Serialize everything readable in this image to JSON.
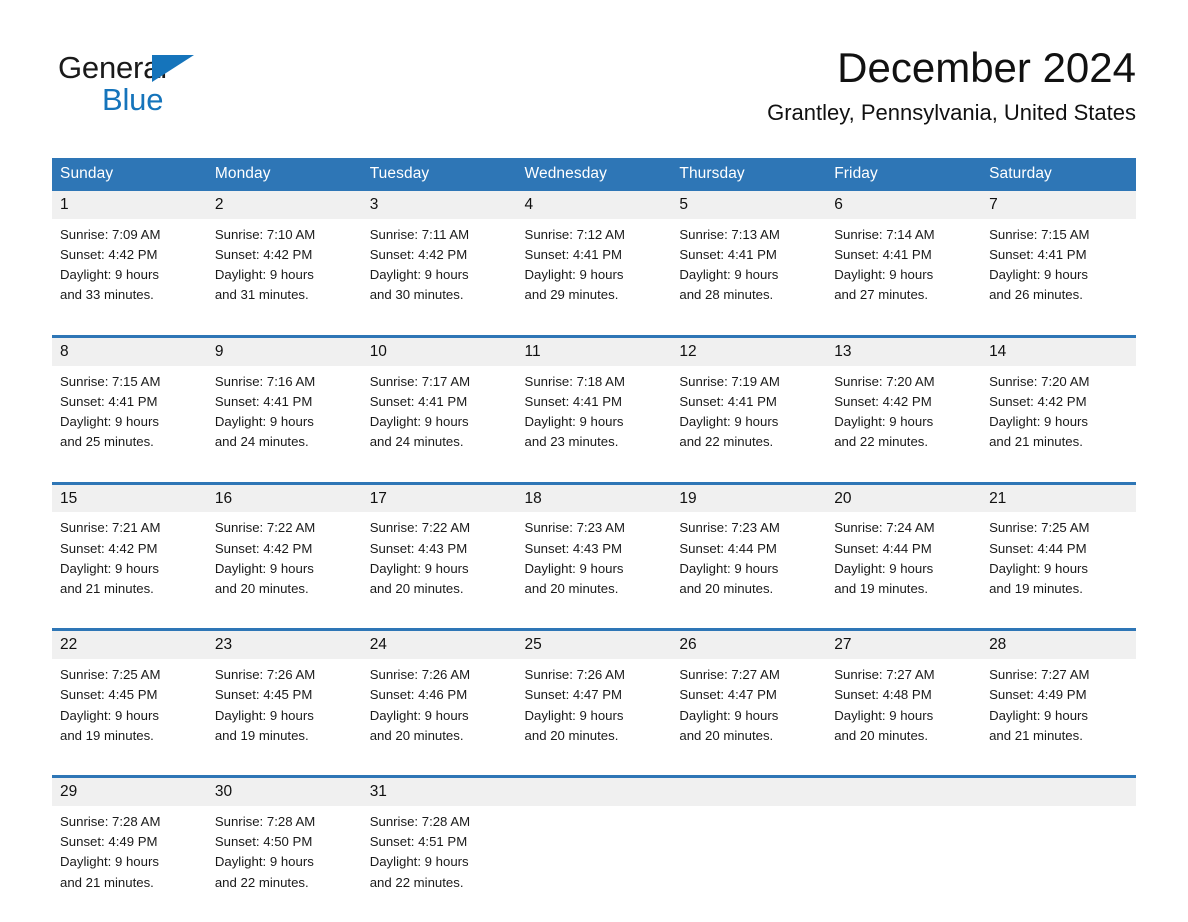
{
  "brand": {
    "name_part1": "General",
    "name_part2": "Blue",
    "triangle_icon": "triangle-logo-icon",
    "color_primary": "#1574bb"
  },
  "header": {
    "title": "December 2024",
    "location": "Grantley, Pennsylvania, United States"
  },
  "theme": {
    "header_blue": "#2e76b6",
    "daynum_band": "#f0f0f0",
    "text": "#1a1a1a"
  },
  "calendar": {
    "weekday_headers": [
      "Sunday",
      "Monday",
      "Tuesday",
      "Wednesday",
      "Thursday",
      "Friday",
      "Saturday"
    ],
    "weeks": [
      {
        "days": [
          {
            "day": "1",
            "sunrise": "Sunrise: 7:09 AM",
            "sunset": "Sunset: 4:42 PM",
            "daylight_line1": "Daylight: 9 hours",
            "daylight_line2": "and 33 minutes."
          },
          {
            "day": "2",
            "sunrise": "Sunrise: 7:10 AM",
            "sunset": "Sunset: 4:42 PM",
            "daylight_line1": "Daylight: 9 hours",
            "daylight_line2": "and 31 minutes."
          },
          {
            "day": "3",
            "sunrise": "Sunrise: 7:11 AM",
            "sunset": "Sunset: 4:42 PM",
            "daylight_line1": "Daylight: 9 hours",
            "daylight_line2": "and 30 minutes."
          },
          {
            "day": "4",
            "sunrise": "Sunrise: 7:12 AM",
            "sunset": "Sunset: 4:41 PM",
            "daylight_line1": "Daylight: 9 hours",
            "daylight_line2": "and 29 minutes."
          },
          {
            "day": "5",
            "sunrise": "Sunrise: 7:13 AM",
            "sunset": "Sunset: 4:41 PM",
            "daylight_line1": "Daylight: 9 hours",
            "daylight_line2": "and 28 minutes."
          },
          {
            "day": "6",
            "sunrise": "Sunrise: 7:14 AM",
            "sunset": "Sunset: 4:41 PM",
            "daylight_line1": "Daylight: 9 hours",
            "daylight_line2": "and 27 minutes."
          },
          {
            "day": "7",
            "sunrise": "Sunrise: 7:15 AM",
            "sunset": "Sunset: 4:41 PM",
            "daylight_line1": "Daylight: 9 hours",
            "daylight_line2": "and 26 minutes."
          }
        ]
      },
      {
        "days": [
          {
            "day": "8",
            "sunrise": "Sunrise: 7:15 AM",
            "sunset": "Sunset: 4:41 PM",
            "daylight_line1": "Daylight: 9 hours",
            "daylight_line2": "and 25 minutes."
          },
          {
            "day": "9",
            "sunrise": "Sunrise: 7:16 AM",
            "sunset": "Sunset: 4:41 PM",
            "daylight_line1": "Daylight: 9 hours",
            "daylight_line2": "and 24 minutes."
          },
          {
            "day": "10",
            "sunrise": "Sunrise: 7:17 AM",
            "sunset": "Sunset: 4:41 PM",
            "daylight_line1": "Daylight: 9 hours",
            "daylight_line2": "and 24 minutes."
          },
          {
            "day": "11",
            "sunrise": "Sunrise: 7:18 AM",
            "sunset": "Sunset: 4:41 PM",
            "daylight_line1": "Daylight: 9 hours",
            "daylight_line2": "and 23 minutes."
          },
          {
            "day": "12",
            "sunrise": "Sunrise: 7:19 AM",
            "sunset": "Sunset: 4:41 PM",
            "daylight_line1": "Daylight: 9 hours",
            "daylight_line2": "and 22 minutes."
          },
          {
            "day": "13",
            "sunrise": "Sunrise: 7:20 AM",
            "sunset": "Sunset: 4:42 PM",
            "daylight_line1": "Daylight: 9 hours",
            "daylight_line2": "and 22 minutes."
          },
          {
            "day": "14",
            "sunrise": "Sunrise: 7:20 AM",
            "sunset": "Sunset: 4:42 PM",
            "daylight_line1": "Daylight: 9 hours",
            "daylight_line2": "and 21 minutes."
          }
        ]
      },
      {
        "days": [
          {
            "day": "15",
            "sunrise": "Sunrise: 7:21 AM",
            "sunset": "Sunset: 4:42 PM",
            "daylight_line1": "Daylight: 9 hours",
            "daylight_line2": "and 21 minutes."
          },
          {
            "day": "16",
            "sunrise": "Sunrise: 7:22 AM",
            "sunset": "Sunset: 4:42 PM",
            "daylight_line1": "Daylight: 9 hours",
            "daylight_line2": "and 20 minutes."
          },
          {
            "day": "17",
            "sunrise": "Sunrise: 7:22 AM",
            "sunset": "Sunset: 4:43 PM",
            "daylight_line1": "Daylight: 9 hours",
            "daylight_line2": "and 20 minutes."
          },
          {
            "day": "18",
            "sunrise": "Sunrise: 7:23 AM",
            "sunset": "Sunset: 4:43 PM",
            "daylight_line1": "Daylight: 9 hours",
            "daylight_line2": "and 20 minutes."
          },
          {
            "day": "19",
            "sunrise": "Sunrise: 7:23 AM",
            "sunset": "Sunset: 4:44 PM",
            "daylight_line1": "Daylight: 9 hours",
            "daylight_line2": "and 20 minutes."
          },
          {
            "day": "20",
            "sunrise": "Sunrise: 7:24 AM",
            "sunset": "Sunset: 4:44 PM",
            "daylight_line1": "Daylight: 9 hours",
            "daylight_line2": "and 19 minutes."
          },
          {
            "day": "21",
            "sunrise": "Sunrise: 7:25 AM",
            "sunset": "Sunset: 4:44 PM",
            "daylight_line1": "Daylight: 9 hours",
            "daylight_line2": "and 19 minutes."
          }
        ]
      },
      {
        "days": [
          {
            "day": "22",
            "sunrise": "Sunrise: 7:25 AM",
            "sunset": "Sunset: 4:45 PM",
            "daylight_line1": "Daylight: 9 hours",
            "daylight_line2": "and 19 minutes."
          },
          {
            "day": "23",
            "sunrise": "Sunrise: 7:26 AM",
            "sunset": "Sunset: 4:45 PM",
            "daylight_line1": "Daylight: 9 hours",
            "daylight_line2": "and 19 minutes."
          },
          {
            "day": "24",
            "sunrise": "Sunrise: 7:26 AM",
            "sunset": "Sunset: 4:46 PM",
            "daylight_line1": "Daylight: 9 hours",
            "daylight_line2": "and 20 minutes."
          },
          {
            "day": "25",
            "sunrise": "Sunrise: 7:26 AM",
            "sunset": "Sunset: 4:47 PM",
            "daylight_line1": "Daylight: 9 hours",
            "daylight_line2": "and 20 minutes."
          },
          {
            "day": "26",
            "sunrise": "Sunrise: 7:27 AM",
            "sunset": "Sunset: 4:47 PM",
            "daylight_line1": "Daylight: 9 hours",
            "daylight_line2": "and 20 minutes."
          },
          {
            "day": "27",
            "sunrise": "Sunrise: 7:27 AM",
            "sunset": "Sunset: 4:48 PM",
            "daylight_line1": "Daylight: 9 hours",
            "daylight_line2": "and 20 minutes."
          },
          {
            "day": "28",
            "sunrise": "Sunrise: 7:27 AM",
            "sunset": "Sunset: 4:49 PM",
            "daylight_line1": "Daylight: 9 hours",
            "daylight_line2": "and 21 minutes."
          }
        ]
      },
      {
        "days": [
          {
            "day": "29",
            "sunrise": "Sunrise: 7:28 AM",
            "sunset": "Sunset: 4:49 PM",
            "daylight_line1": "Daylight: 9 hours",
            "daylight_line2": "and 21 minutes."
          },
          {
            "day": "30",
            "sunrise": "Sunrise: 7:28 AM",
            "sunset": "Sunset: 4:50 PM",
            "daylight_line1": "Daylight: 9 hours",
            "daylight_line2": "and 22 minutes."
          },
          {
            "day": "31",
            "sunrise": "Sunrise: 7:28 AM",
            "sunset": "Sunset: 4:51 PM",
            "daylight_line1": "Daylight: 9 hours",
            "daylight_line2": "and 22 minutes."
          },
          {
            "day": "",
            "sunrise": "",
            "sunset": "",
            "daylight_line1": "",
            "daylight_line2": ""
          },
          {
            "day": "",
            "sunrise": "",
            "sunset": "",
            "daylight_line1": "",
            "daylight_line2": ""
          },
          {
            "day": "",
            "sunrise": "",
            "sunset": "",
            "daylight_line1": "",
            "daylight_line2": ""
          },
          {
            "day": "",
            "sunrise": "",
            "sunset": "",
            "daylight_line1": "",
            "daylight_line2": ""
          }
        ]
      }
    ]
  }
}
